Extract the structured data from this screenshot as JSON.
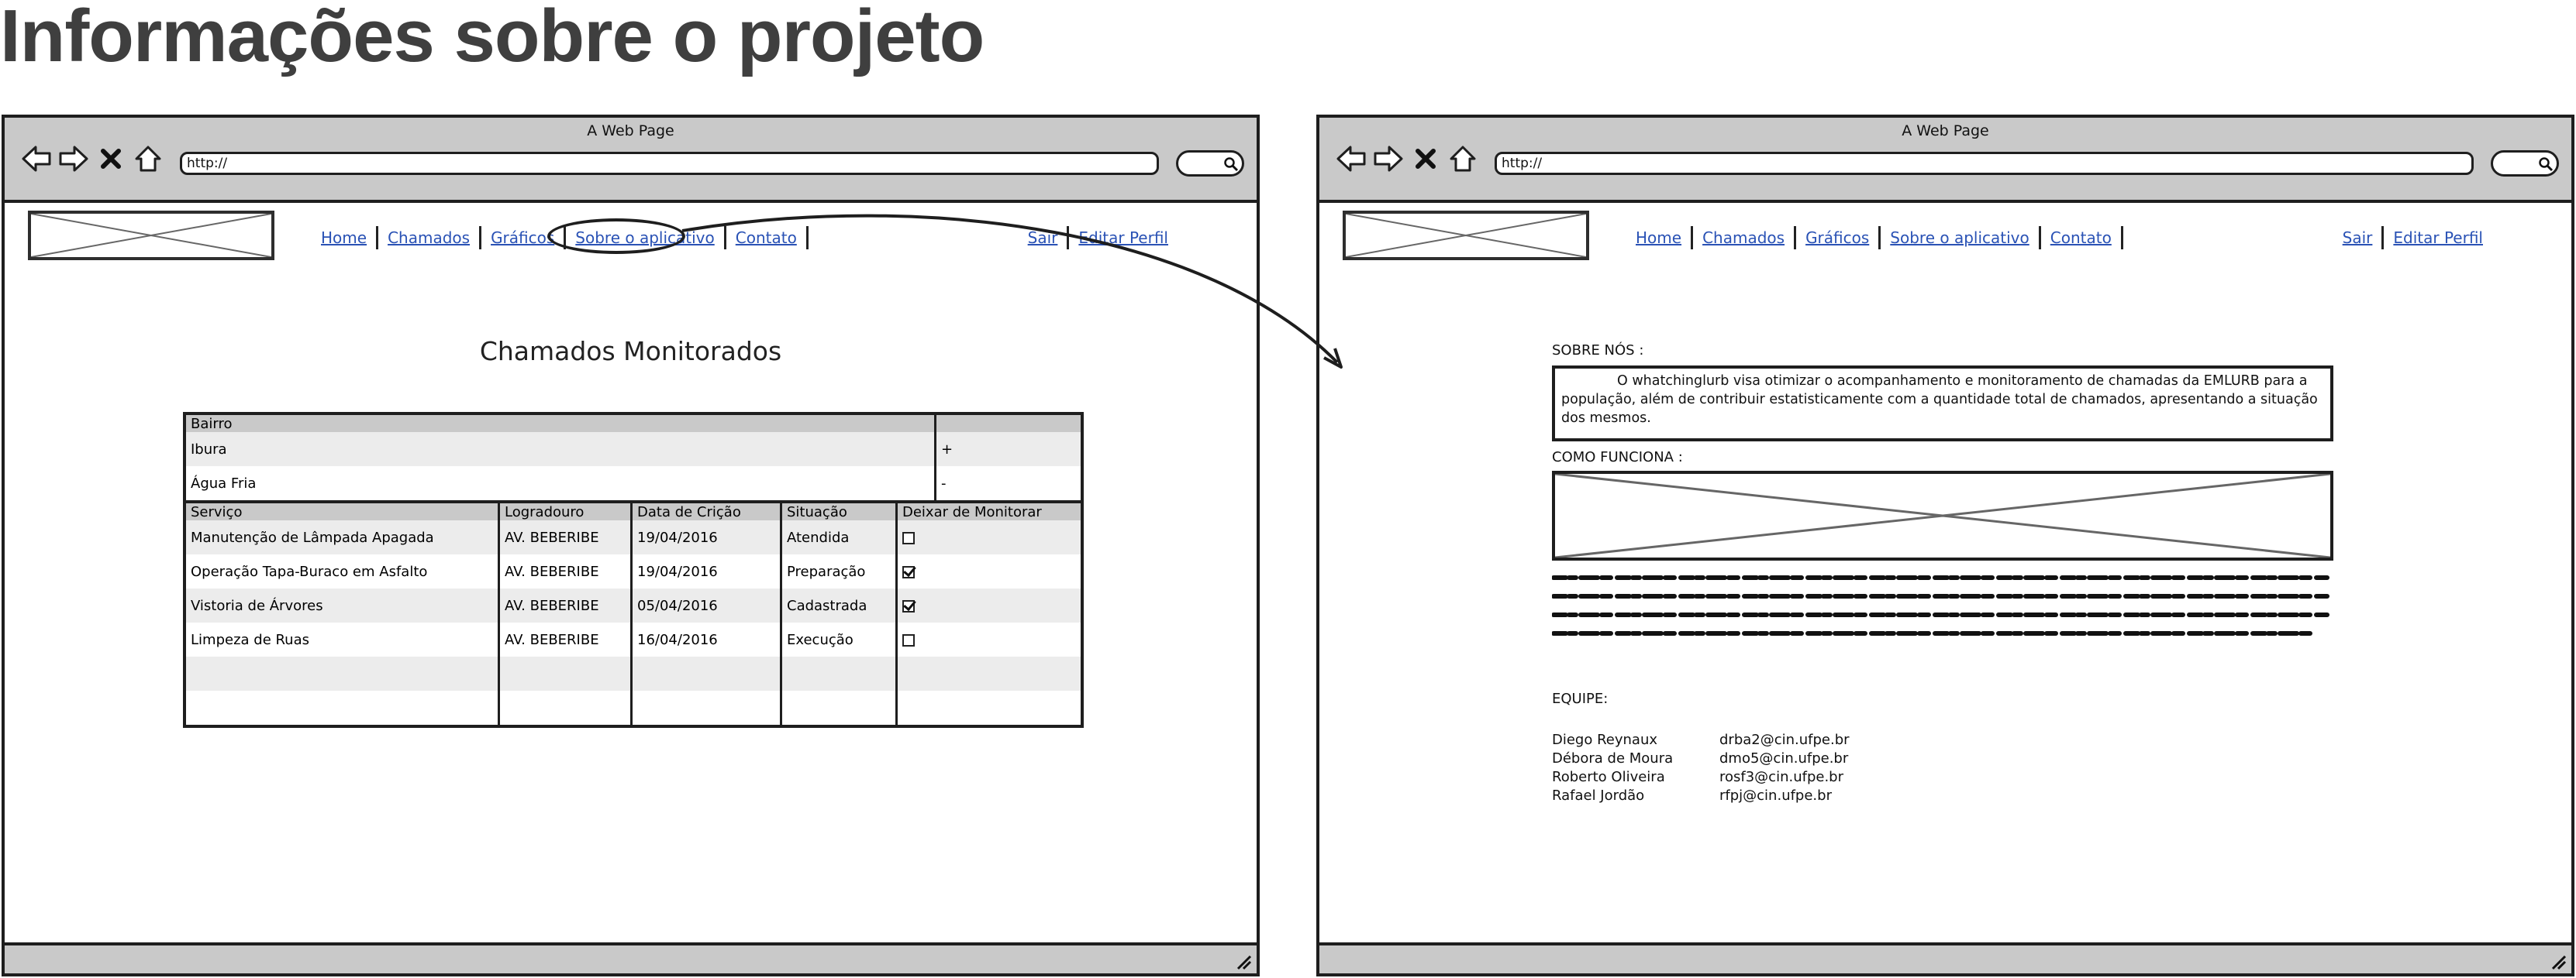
{
  "page_title": "Informações sobre o projeto",
  "browser": {
    "window_title": "A Web Page",
    "url": "http://"
  },
  "nav": {
    "links": [
      "Home",
      "Chamados",
      "Gráficos",
      "Sobre o aplicativo",
      "Contato"
    ],
    "right_links": [
      "Sair",
      "Editar Perfil"
    ]
  },
  "left_page": {
    "heading": "Chamados Monitorados",
    "bairro_table": {
      "header": "Bairro",
      "rows": [
        {
          "name": "Ibura",
          "sign": "+"
        },
        {
          "name": "Água Fria",
          "sign": "-"
        }
      ]
    },
    "servico_table": {
      "columns": [
        "Serviço",
        "Logradouro",
        "Data de Crição",
        "Situação",
        "Deixar de Monitorar"
      ],
      "rows": [
        {
          "servico": "Manutenção de Lâmpada Apagada",
          "logradouro": "AV. BEBERIBE",
          "data": "19/04/2016",
          "situacao": "Atendida",
          "checked": false
        },
        {
          "servico": "Operação Tapa-Buraco em Asfalto",
          "logradouro": "AV. BEBERIBE",
          "data": "19/04/2016",
          "situacao": "Preparação",
          "checked": true
        },
        {
          "servico": "Vistoria de Árvores",
          "logradouro": "AV. BEBERIBE",
          "data": "05/04/2016",
          "situacao": "Cadastrada",
          "checked": true
        },
        {
          "servico": "Limpeza de Ruas",
          "logradouro": "AV. BEBERIBE",
          "data": "16/04/2016",
          "situacao": "Execução",
          "checked": false
        }
      ]
    }
  },
  "right_page": {
    "about_label": "SOBRE NÓS :",
    "about_text": "O whatchinglurb visa otimizar o acompanhamento e monitoramento de chamadas da EMLURB para a população, além de contribuir estatisticamente com a quantidade total de chamados, apresentando a situação dos mesmos.",
    "how_label": "COMO FUNCIONA :",
    "team_label": "EQUIPE:",
    "team": [
      {
        "name": "Diego Reynaux",
        "email": "drba2@cin.ufpe.br"
      },
      {
        "name": "Débora de Moura",
        "email": "dmo5@cin.ufpe.br"
      },
      {
        "name": "Roberto Oliveira",
        "email": "rosf3@cin.ufpe.br"
      },
      {
        "name": "Rafael Jordão",
        "email": "rfpj@cin.ufpe.br"
      }
    ]
  },
  "icons": [
    "back-arrow-icon",
    "forward-arrow-icon",
    "close-icon",
    "home-icon",
    "search-icon",
    "resize-grip-icon"
  ]
}
